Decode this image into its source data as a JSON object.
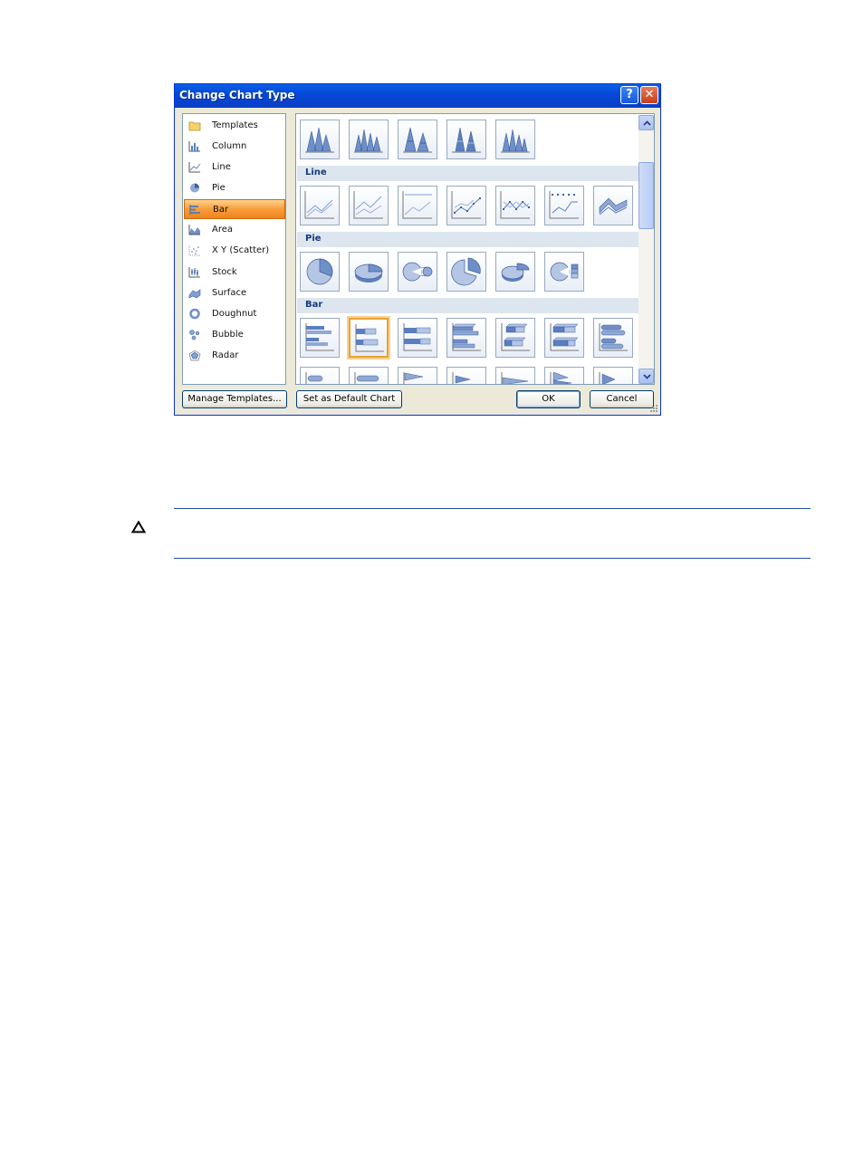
{
  "dialog": {
    "title": "Change Chart Type",
    "help_icon": "help-icon",
    "close_icon": "close-icon"
  },
  "chart_types": [
    {
      "label": "Templates",
      "icon": "folder-icon",
      "selected": false
    },
    {
      "label": "Column",
      "icon": "column-chart-icon",
      "selected": false
    },
    {
      "label": "Line",
      "icon": "line-chart-icon",
      "selected": false
    },
    {
      "label": "Pie",
      "icon": "pie-chart-icon",
      "selected": false
    },
    {
      "label": "Bar",
      "icon": "bar-chart-icon",
      "selected": true
    },
    {
      "label": "Area",
      "icon": "area-chart-icon",
      "selected": false
    },
    {
      "label": "X Y (Scatter)",
      "icon": "scatter-chart-icon",
      "selected": false
    },
    {
      "label": "Stock",
      "icon": "stock-chart-icon",
      "selected": false
    },
    {
      "label": "Surface",
      "icon": "surface-chart-icon",
      "selected": false
    },
    {
      "label": "Doughnut",
      "icon": "doughnut-chart-icon",
      "selected": false
    },
    {
      "label": "Bubble",
      "icon": "bubble-chart-icon",
      "selected": false
    },
    {
      "label": "Radar",
      "icon": "radar-chart-icon",
      "selected": false
    }
  ],
  "gallery": {
    "sections": [
      {
        "title": "Line"
      },
      {
        "title": "Pie"
      },
      {
        "title": "Bar"
      }
    ]
  },
  "buttons": {
    "manage_templates": "Manage Templates...",
    "set_default": "Set as Default Chart",
    "ok": "OK",
    "cancel": "Cancel"
  },
  "note": {
    "icon": "caution-icon"
  },
  "colors": {
    "title_bar": "#0548d8",
    "selection": "#f79e3a",
    "chart_blue": "#5a7fbf",
    "section_header_text": "#143a80"
  }
}
